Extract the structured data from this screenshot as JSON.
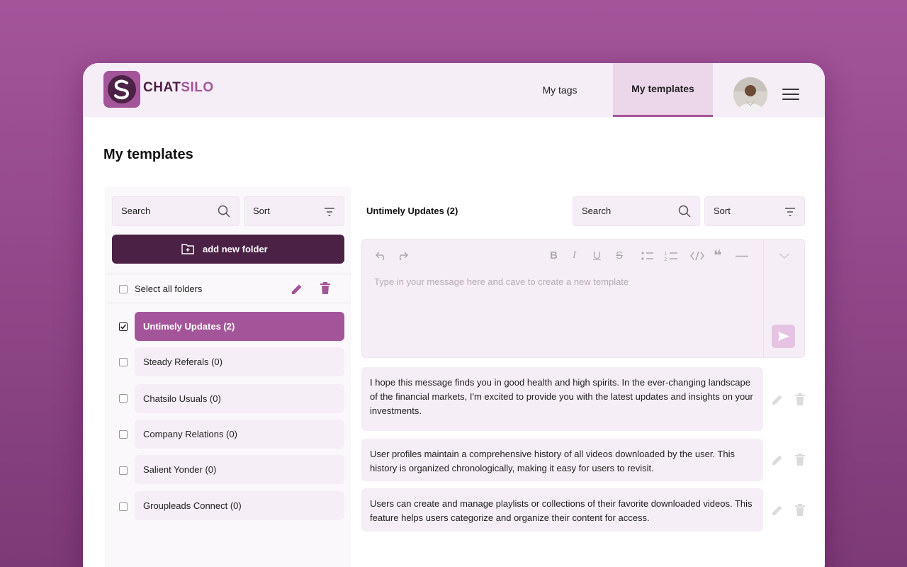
{
  "brand": {
    "part1": "CHAT",
    "part2": "SILO",
    "accent": "#a4559a",
    "dark": "#4b2146"
  },
  "nav": {
    "tags": "My tags",
    "templates": "My templates"
  },
  "page": {
    "title": "My templates"
  },
  "folders_panel": {
    "search_placeholder": "Search",
    "sort_label": "Sort",
    "add_folder_label": "add new folder",
    "select_all_label": "Select all folders",
    "items": [
      {
        "label": "Untimely Updates (2)",
        "checked": true,
        "active": true
      },
      {
        "label": "Steady Referals (0)",
        "checked": false
      },
      {
        "label": "Chatsilo Usuals (0)",
        "checked": false
      },
      {
        "label": "Company Relations (0)",
        "checked": false
      },
      {
        "label": "Salient Yonder (0)",
        "checked": false
      },
      {
        "label": "Groupleads Connect (0)",
        "checked": false
      }
    ]
  },
  "templates_panel": {
    "title": "Untimely Updates (2)",
    "search_placeholder": "Search",
    "sort_label": "Sort",
    "editor_placeholder": "Type in your message here and cave to create a new template",
    "toolbar": [
      "undo-icon",
      "redo-icon",
      "bold-icon",
      "italic-icon",
      "underline-icon",
      "strikethrough-icon",
      "bullet-list-icon",
      "numbered-list-icon",
      "code-icon",
      "quote-icon",
      "horizontal-rule-icon"
    ],
    "templates": [
      {
        "text": "I hope this message finds you in good health and high spirits. In the ever-changing landscape of the financial markets, I'm excited to provide you with the latest updates and insights on your investments."
      },
      {
        "text": "User profiles maintain a comprehensive history of all videos downloaded by the user. This history is organized chronologically, making it easy for users to revisit."
      },
      {
        "text": "Users can create and manage playlists or collections of their favorite downloaded videos. This feature helps users categorize and organize their content for access."
      }
    ]
  }
}
